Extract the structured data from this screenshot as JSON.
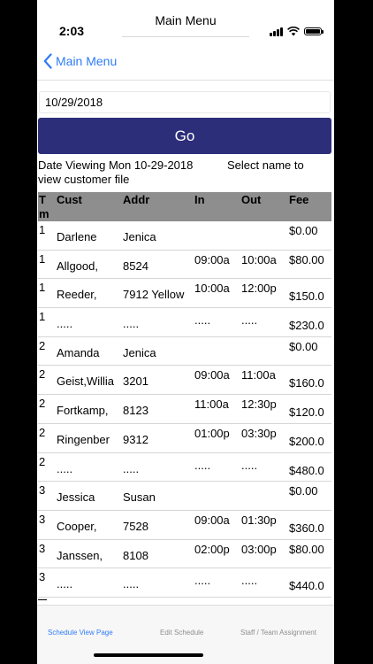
{
  "status": {
    "time": "2:03",
    "title": "Main Menu"
  },
  "nav": {
    "back_label": "Main Menu"
  },
  "date_field": {
    "value": "10/29/2018"
  },
  "go_button": {
    "label": "Go"
  },
  "info": {
    "date_viewing": "Date Viewing Mon 10-29-2018",
    "select_hint": "Select name to",
    "select_hint_cont": "view customer file"
  },
  "table": {
    "headers": {
      "tm": "T m",
      "cust": "Cust",
      "addr": "Addr",
      "in": "In",
      "out": "Out",
      "fee": "Fee"
    },
    "rows": [
      {
        "tm": "1",
        "cust": "Darlene",
        "addr": "Jenica",
        "in": "",
        "out": "",
        "fee": "$0.00"
      },
      {
        "tm": "1",
        "cust": "Allgood,",
        "addr": "8524",
        "in": "09:00a",
        "out": "10:00a",
        "fee": "$80.00"
      },
      {
        "tm": "1",
        "cust": "Reeder,",
        "addr": "7912 Yellow",
        "in": "10:00a",
        "out": "12:00p",
        "fee": "$150.0"
      },
      {
        "tm": "1",
        "cust": ".....",
        "addr": ".....",
        "in": ".....",
        "out": ".....",
        "fee": "$230.0"
      },
      {
        "tm": "2",
        "cust": "Amanda",
        "addr": "Jenica",
        "in": "",
        "out": "",
        "fee": "$0.00"
      },
      {
        "tm": "2",
        "cust": "Geist,Willia",
        "addr": "3201",
        "in": "09:00a",
        "out": "11:00a",
        "fee": "$160.0"
      },
      {
        "tm": "2",
        "cust": "Fortkamp,",
        "addr": "8123",
        "in": "11:00a",
        "out": "12:30p",
        "fee": "$120.0"
      },
      {
        "tm": "2",
        "cust": "Ringenber",
        "addr": "9312",
        "in": "01:00p",
        "out": "03:30p",
        "fee": "$200.0"
      },
      {
        "tm": "2",
        "cust": ".....",
        "addr": ".....",
        "in": ".....",
        "out": ".....",
        "fee": "$480.0"
      },
      {
        "tm": "3",
        "cust": "Jessica",
        "addr": "Susan",
        "in": "",
        "out": "",
        "fee": "$0.00"
      },
      {
        "tm": "3",
        "cust": "Cooper,",
        "addr": "7528",
        "in": "09:00a",
        "out": "01:30p",
        "fee": "$360.0"
      },
      {
        "tm": "3",
        "cust": "Janssen,",
        "addr": "8108",
        "in": "02:00p",
        "out": "03:00p",
        "fee": "$80.00"
      },
      {
        "tm": "3",
        "cust": ".....",
        "addr": ".....",
        "in": ".....",
        "out": ".....",
        "fee": "$440.0"
      }
    ]
  },
  "tabs": [
    {
      "label": "Schedule View Page"
    },
    {
      "label": "Edit Schedule"
    },
    {
      "label": "Staff / Team Assignment"
    }
  ],
  "colors": {
    "accent": "#2f7cf6",
    "go_button": "#2d2e7a",
    "header_bg": "#8e8e8e"
  }
}
